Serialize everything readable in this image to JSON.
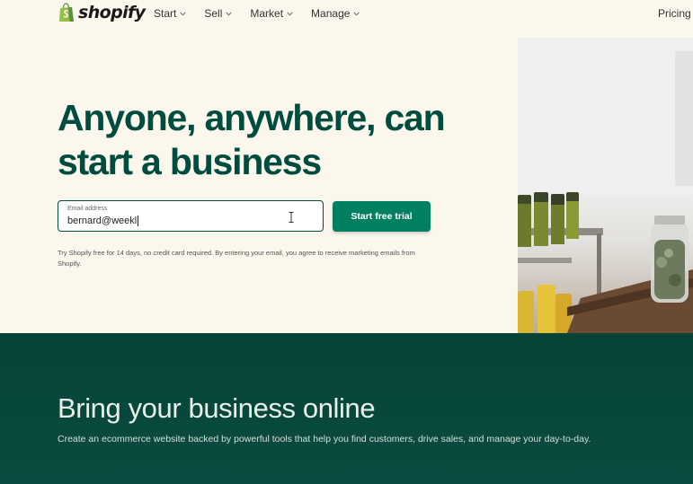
{
  "nav": {
    "logo_text": "shopify",
    "items": [
      {
        "label": "Start"
      },
      {
        "label": "Sell"
      },
      {
        "label": "Market"
      },
      {
        "label": "Manage"
      }
    ],
    "pricing_label": "Pricing"
  },
  "hero": {
    "title_line1": "Anyone, anywhere, can",
    "title_line2": "start a business",
    "email_label": "Email address",
    "email_value": "bernard@weekl",
    "cta_label": "Start free trial",
    "disclaimer": "Try Shopify free for 14 days, no credit card required. By entering your email, you agree to receive marketing emails from Shopify."
  },
  "section": {
    "title": "Bring your business online",
    "subtitle": "Create an ecommerce website backed by powerful tools that help you find customers, drive sales, and manage your day-to-day."
  },
  "colors": {
    "brand_green": "#004c3f",
    "button_green": "#008060",
    "logo_green": "#95bf47",
    "page_background": "#fbf7ed",
    "section_background": "#074237"
  },
  "icons": {
    "logo": "shopping-bag-icon",
    "dropdown": "chevron-down-icon",
    "cursor": "text-cursor-icon"
  }
}
